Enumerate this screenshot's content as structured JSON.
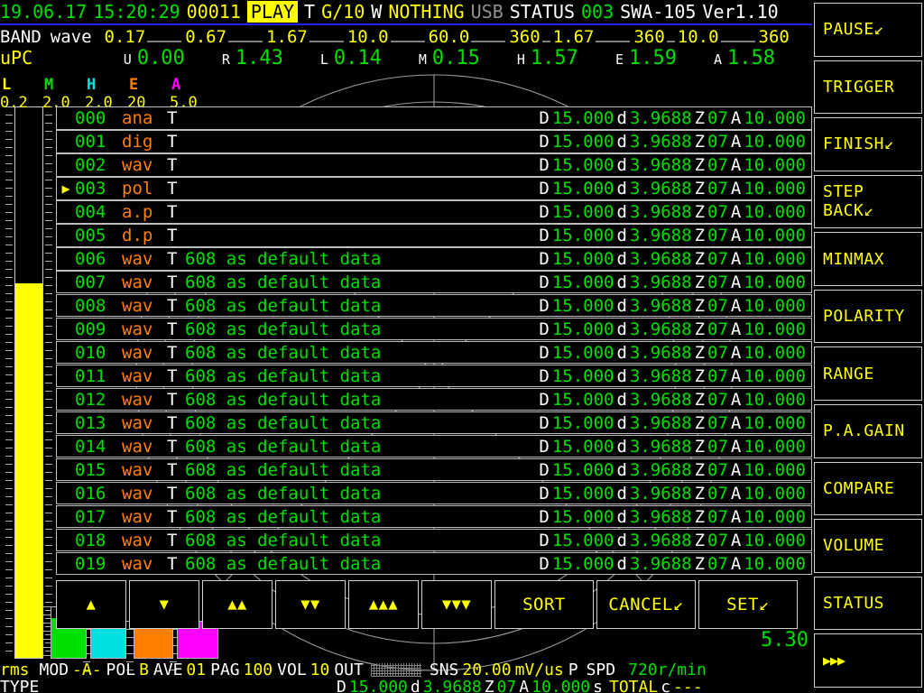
{
  "header": {
    "date": "19.06.17",
    "time": "15:20:29",
    "counter": "00011",
    "mode": "PLAY",
    "t_key": "T",
    "t_val": "G/10",
    "w_key": "W",
    "w_val": "NOTHING",
    "usb": "USB",
    "status_key": "STATUS",
    "status_val": "003",
    "model": "SWA-105",
    "version": "Ver1.10"
  },
  "band": {
    "label": "BAND",
    "sub": "wave",
    "values": [
      "0.17",
      "0.67",
      "1.67",
      "10.0",
      "60.0",
      "360",
      "1.67",
      "360",
      "10.0",
      "360"
    ]
  },
  "upc": {
    "title": "uPC",
    "items": [
      {
        "key": "U",
        "value": "0.00"
      },
      {
        "key": "R",
        "value": "1.43"
      },
      {
        "key": "L",
        "value": "0.14"
      },
      {
        "key": "M",
        "value": "0.15"
      },
      {
        "key": "H",
        "value": "1.57"
      },
      {
        "key": "E",
        "value": "1.59"
      },
      {
        "key": "A",
        "value": "1.58"
      }
    ]
  },
  "legend": [
    {
      "key": "L",
      "value": "0.2",
      "color": "#ffff00"
    },
    {
      "key": "M",
      "value": "2.0",
      "color": "#00e000"
    },
    {
      "key": "H",
      "value": "2.0",
      "color": "#00e0e0"
    },
    {
      "key": "E",
      "value": "20",
      "color": "#ff8000"
    },
    {
      "key": "A",
      "value": "5.0",
      "color": "#ff00ff"
    }
  ],
  "meters": [
    {
      "name": "l-meter",
      "color": "#ffff00",
      "fill_pct": 68
    },
    {
      "name": "m-meter",
      "color": "#00e000",
      "fill_pct": 8
    },
    {
      "name": "h-meter",
      "color": "#00e0e0",
      "fill_pct": 6
    },
    {
      "name": "e-meter",
      "color": "#ff8000",
      "fill_pct": 6
    },
    {
      "name": "a-meter",
      "color": "#ff00ff",
      "fill_pct": 6
    }
  ],
  "table": {
    "rows": [
      {
        "marker": "",
        "idx": "000",
        "type": "ana",
        "t": "T",
        "note": "",
        "d_key": "D",
        "d_val": "15.000",
        "dd_key": "d",
        "dd_val": "3.9688",
        "z_key": "Z",
        "z_val": "07",
        "a_key": "A",
        "a_val": "10.000"
      },
      {
        "marker": "",
        "idx": "001",
        "type": "dig",
        "t": "T",
        "note": "",
        "d_key": "D",
        "d_val": "15.000",
        "dd_key": "d",
        "dd_val": "3.9688",
        "z_key": "Z",
        "z_val": "07",
        "a_key": "A",
        "a_val": "10.000"
      },
      {
        "marker": "",
        "idx": "002",
        "type": "wav",
        "t": "T",
        "note": "",
        "d_key": "D",
        "d_val": "15.000",
        "dd_key": "d",
        "dd_val": "3.9688",
        "z_key": "Z",
        "z_val": "07",
        "a_key": "A",
        "a_val": "10.000"
      },
      {
        "marker": "▶",
        "idx": "003",
        "type": "pol",
        "t": "T",
        "note": "",
        "d_key": "D",
        "d_val": "15.000",
        "dd_key": "d",
        "dd_val": "3.9688",
        "z_key": "Z",
        "z_val": "07",
        "a_key": "A",
        "a_val": "10.000"
      },
      {
        "marker": "",
        "idx": "004",
        "type": "a.p",
        "t": "T",
        "note": "",
        "d_key": "D",
        "d_val": "15.000",
        "dd_key": "d",
        "dd_val": "3.9688",
        "z_key": "Z",
        "z_val": "07",
        "a_key": "A",
        "a_val": "10.000"
      },
      {
        "marker": "",
        "idx": "005",
        "type": "d.p",
        "t": "T",
        "note": "",
        "d_key": "D",
        "d_val": "15.000",
        "dd_key": "d",
        "dd_val": "3.9688",
        "z_key": "Z",
        "z_val": "07",
        "a_key": "A",
        "a_val": "10.000"
      },
      {
        "marker": "",
        "idx": "006",
        "type": "wav",
        "t": "T",
        "note": "608 as default data",
        "d_key": "D",
        "d_val": "15.000",
        "dd_key": "d",
        "dd_val": "3.9688",
        "z_key": "Z",
        "z_val": "07",
        "a_key": "A",
        "a_val": "10.000"
      },
      {
        "marker": "",
        "idx": "007",
        "type": "wav",
        "t": "T",
        "note": "608 as default data",
        "d_key": "D",
        "d_val": "15.000",
        "dd_key": "d",
        "dd_val": "3.9688",
        "z_key": "Z",
        "z_val": "07",
        "a_key": "A",
        "a_val": "10.000"
      },
      {
        "marker": "",
        "idx": "008",
        "type": "wav",
        "t": "T",
        "note": "608 as default data",
        "d_key": "D",
        "d_val": "15.000",
        "dd_key": "d",
        "dd_val": "3.9688",
        "z_key": "Z",
        "z_val": "07",
        "a_key": "A",
        "a_val": "10.000"
      },
      {
        "marker": "",
        "idx": "009",
        "type": "wav",
        "t": "T",
        "note": "608 as default data",
        "d_key": "D",
        "d_val": "15.000",
        "dd_key": "d",
        "dd_val": "3.9688",
        "z_key": "Z",
        "z_val": "07",
        "a_key": "A",
        "a_val": "10.000"
      },
      {
        "marker": "",
        "idx": "010",
        "type": "wav",
        "t": "T",
        "note": "608 as default data",
        "d_key": "D",
        "d_val": "15.000",
        "dd_key": "d",
        "dd_val": "3.9688",
        "z_key": "Z",
        "z_val": "07",
        "a_key": "A",
        "a_val": "10.000"
      },
      {
        "marker": "",
        "idx": "011",
        "type": "wav",
        "t": "T",
        "note": "608 as default data",
        "d_key": "D",
        "d_val": "15.000",
        "dd_key": "d",
        "dd_val": "3.9688",
        "z_key": "Z",
        "z_val": "07",
        "a_key": "A",
        "a_val": "10.000"
      },
      {
        "marker": "",
        "idx": "012",
        "type": "wav",
        "t": "T",
        "note": "608 as default data",
        "d_key": "D",
        "d_val": "15.000",
        "dd_key": "d",
        "dd_val": "3.9688",
        "z_key": "Z",
        "z_val": "07",
        "a_key": "A",
        "a_val": "10.000"
      },
      {
        "marker": "",
        "idx": "013",
        "type": "wav",
        "t": "T",
        "note": "608 as default data",
        "d_key": "D",
        "d_val": "15.000",
        "dd_key": "d",
        "dd_val": "3.9688",
        "z_key": "Z",
        "z_val": "07",
        "a_key": "A",
        "a_val": "10.000"
      },
      {
        "marker": "",
        "idx": "014",
        "type": "wav",
        "t": "T",
        "note": "608 as default data",
        "d_key": "D",
        "d_val": "15.000",
        "dd_key": "d",
        "dd_val": "3.9688",
        "z_key": "Z",
        "z_val": "07",
        "a_key": "A",
        "a_val": "10.000"
      },
      {
        "marker": "",
        "idx": "015",
        "type": "wav",
        "t": "T",
        "note": "608 as default data",
        "d_key": "D",
        "d_val": "15.000",
        "dd_key": "d",
        "dd_val": "3.9688",
        "z_key": "Z",
        "z_val": "07",
        "a_key": "A",
        "a_val": "10.000"
      },
      {
        "marker": "",
        "idx": "016",
        "type": "wav",
        "t": "T",
        "note": "608 as default data",
        "d_key": "D",
        "d_val": "15.000",
        "dd_key": "d",
        "dd_val": "3.9688",
        "z_key": "Z",
        "z_val": "07",
        "a_key": "A",
        "a_val": "10.000"
      },
      {
        "marker": "",
        "idx": "017",
        "type": "wav",
        "t": "T",
        "note": "608 as default data",
        "d_key": "D",
        "d_val": "15.000",
        "dd_key": "d",
        "dd_val": "3.9688",
        "z_key": "Z",
        "z_val": "07",
        "a_key": "A",
        "a_val": "10.000"
      },
      {
        "marker": "",
        "idx": "018",
        "type": "wav",
        "t": "T",
        "note": "608 as default data",
        "d_key": "D",
        "d_val": "15.000",
        "dd_key": "d",
        "dd_val": "3.9688",
        "z_key": "Z",
        "z_val": "07",
        "a_key": "A",
        "a_val": "10.000"
      },
      {
        "marker": "",
        "idx": "019",
        "type": "wav",
        "t": "T",
        "note": "608 as default data",
        "d_key": "D",
        "d_val": "15.000",
        "dd_key": "d",
        "dd_val": "3.9688",
        "z_key": "Z",
        "z_val": "07",
        "a_key": "A",
        "a_val": "10.000"
      }
    ]
  },
  "toolbar": [
    {
      "name": "up-one-button",
      "label": "▲",
      "kind": "arrow"
    },
    {
      "name": "down-one-button",
      "label": "▼",
      "kind": "arrow"
    },
    {
      "name": "up-two-button",
      "label": "▲▲",
      "kind": "arrow"
    },
    {
      "name": "down-two-button",
      "label": "▼▼",
      "kind": "arrow"
    },
    {
      "name": "up-three-button",
      "label": "▲▲▲",
      "kind": "arrow"
    },
    {
      "name": "down-three-button",
      "label": "▼▼▼",
      "kind": "arrow"
    },
    {
      "name": "sort-button",
      "label": "SORT",
      "kind": "wide"
    },
    {
      "name": "cancel-button",
      "label": "CANCEL↙",
      "kind": "wide"
    },
    {
      "name": "set-button",
      "label": "SET↙",
      "kind": "wide"
    }
  ],
  "sidebar": [
    {
      "name": "pause-button",
      "label": "PAUSE↙",
      "lines": [
        "PAUSE↙"
      ]
    },
    {
      "name": "trigger-button",
      "label": "TRIGGER",
      "lines": [
        "TRIGGER"
      ]
    },
    {
      "name": "finish-button",
      "label": "FINISH↙",
      "lines": [
        "FINISH↙"
      ]
    },
    {
      "name": "step-back-button",
      "label": "STEP BACK↙",
      "lines": [
        "STEP",
        "BACK↙"
      ]
    },
    {
      "name": "minmax-button",
      "label": "MINMAX",
      "lines": [
        "MINMAX"
      ]
    },
    {
      "name": "polarity-button",
      "label": "POLARITY",
      "lines": [
        "POLARITY"
      ]
    },
    {
      "name": "range-button",
      "label": "RANGE",
      "lines": [
        "RANGE"
      ]
    },
    {
      "name": "pa-gain-button",
      "label": "P.A.GAIN",
      "lines": [
        "P.A.GAIN"
      ]
    },
    {
      "name": "compare-button",
      "label": "COMPARE",
      "lines": [
        "COMPARE"
      ]
    },
    {
      "name": "volume-button",
      "label": "VOLUME",
      "lines": [
        "VOLUME"
      ]
    },
    {
      "name": "status-button",
      "label": "STATUS",
      "lines": [
        "STATUS"
      ]
    },
    {
      "name": "next-page-button",
      "label": "▶▶▶",
      "lines": [
        "▶▶▶"
      ]
    }
  ],
  "readout": {
    "value": "5.30"
  },
  "status_line1": {
    "rms": "rms",
    "mod_key": "MOD",
    "mod_val": "-A-",
    "pol_key": "POL",
    "pol_val": "B",
    "ave_key": "AVE",
    "ave_val": "01",
    "pag_key": "PAG",
    "pag_val": "100",
    "vol_key": "VOL",
    "vol_val": "10",
    "out_key": "OUT",
    "sns_key": "SNS",
    "sns_val": "20.00",
    "sns_unit": "mV/us",
    "p_key": "P",
    "spd_key": "SPD",
    "spd_val": "720",
    "spd_unit": "r/min"
  },
  "status_line2": {
    "type_label": "TYPE",
    "d_key": "D",
    "d_val": "15.000",
    "dd_key": "d",
    "dd_val": "3.9688",
    "z_key": "Z",
    "z_val": "07",
    "a_key": "A",
    "a_val": "10.000",
    "s_key": "s",
    "total_label": "TOTAL",
    "c_key": "c",
    "c_val": "---"
  }
}
